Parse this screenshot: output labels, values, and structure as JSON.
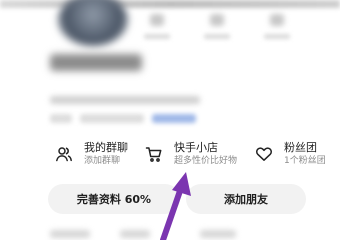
{
  "features": [
    {
      "title": "我的群聊",
      "subtitle": "添加群聊",
      "icon": "group-chat-icon"
    },
    {
      "title": "快手小店",
      "subtitle": "超多性价比好物",
      "icon": "shopping-cart-icon"
    },
    {
      "title": "粉丝团",
      "subtitle": "1个粉丝团",
      "icon": "heart-icon"
    }
  ],
  "buttons": {
    "complete_profile": "完善资料 60%",
    "add_friend": "添加朋友"
  },
  "colors": {
    "arrow": "#7b35b0",
    "button_bg": "#f2f2f2",
    "subtitle": "#8c8c8c"
  }
}
